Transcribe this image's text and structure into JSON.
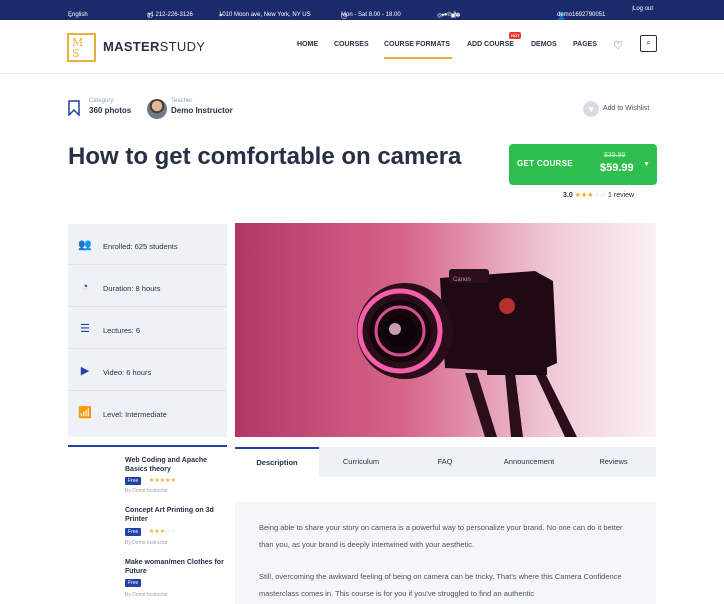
{
  "topbar": {
    "language": "English",
    "phone": "+1 212-226-3126",
    "address": "1010 Moon ave, New York, NY US",
    "hours": "Mon - Sat 8.00 - 18.00",
    "username": "demo1692790051",
    "logout": "Log out",
    "social_icons": [
      "instagram-icon",
      "twitter-icon",
      "facebook-icon",
      "pinterest-icon",
      "linkedin-icon",
      "behance-icon",
      "dribbble-icon"
    ]
  },
  "header": {
    "logo_mark": "M S",
    "logo_bold": "MASTER",
    "logo_thin": "STUDY",
    "nav": [
      "HOME",
      "COURSES",
      "COURSE FORMATS",
      "ADD COURSE",
      "DEMOS",
      "PAGES"
    ],
    "hot_badge": "HOT",
    "accent_color": "#e8b13b"
  },
  "course": {
    "category_label": "Category:",
    "category_value": "360 photos",
    "teacher_label": "Teacher",
    "teacher_name": "Demo Instructor",
    "wishlist": "Add to Wishlist",
    "title": "How to get comfortable on camera",
    "get_course": "GET COURSE",
    "old_price": "$39.99",
    "price": "$59.99",
    "rating_value": "3.0",
    "rating_stars": 3,
    "reviews": "1 review"
  },
  "info": [
    {
      "icon": "students-icon",
      "text": "Enrolled: 625 students"
    },
    {
      "icon": "clock-icon",
      "text": "Duration: 8 hours"
    },
    {
      "icon": "lectures-icon",
      "text": "Lectures: 6"
    },
    {
      "icon": "play-icon",
      "text": "Video: 6 hours"
    },
    {
      "icon": "level-icon",
      "text": "Level: Intermediate"
    }
  ],
  "related": [
    {
      "title": "Web Coding and Apache Basics theory",
      "badge": "Free",
      "stars": 5,
      "by": "By Demo Instructor"
    },
    {
      "title": "Concept Art Printing on 3d Printer",
      "badge": "Free",
      "stars": 3,
      "by": "By Demo Instructor"
    },
    {
      "title": "Make woman/men Clothes for Future",
      "badge": "Free",
      "stars": 0,
      "by": "By Demo Instructor"
    }
  ],
  "tabs": [
    "Description",
    "Curriculum",
    "FAQ",
    "Announcement",
    "Reviews"
  ],
  "description": {
    "p1": "Being able to share your story on camera is a powerful way to personalize your brand. No one can do it better than you, as your brand is deeply intertwined with your aesthetic.",
    "p2": "Still, overcoming the awkward feeling of being on camera can be tricky. That's where this Camera Confidence masterclass comes in. This course is for you if you've struggled to find an authentic"
  },
  "colors": {
    "navy": "#1b2a6b",
    "primary": "#2241a6",
    "green": "#2dbe4e",
    "star": "#f3a928"
  }
}
